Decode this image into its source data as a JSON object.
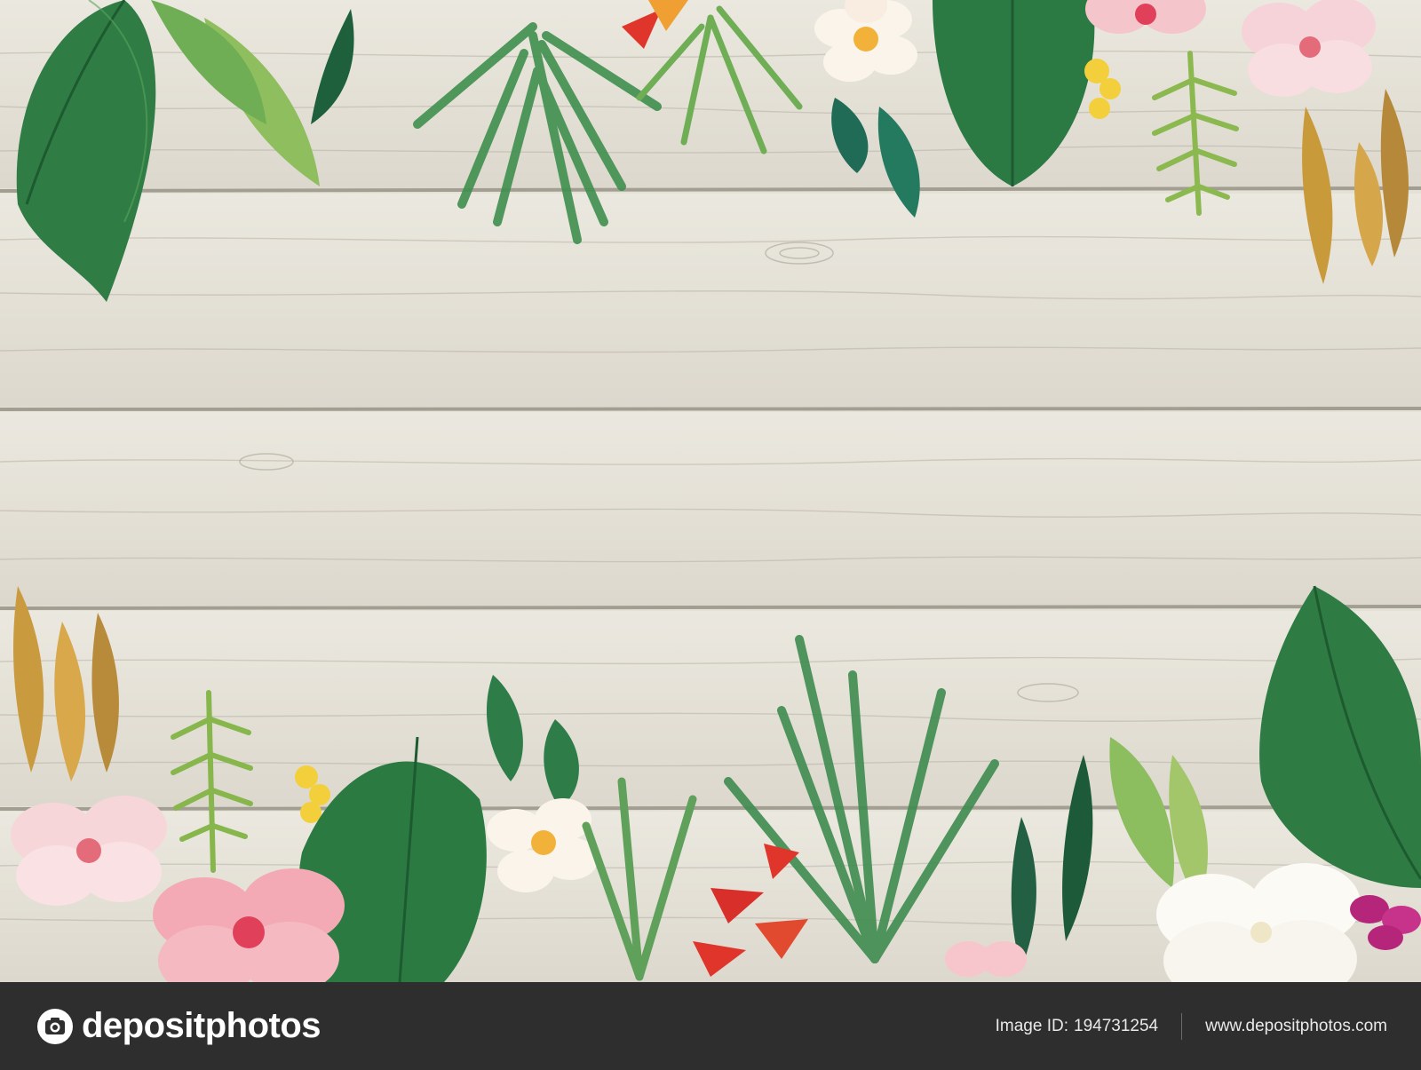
{
  "scene": {
    "description_colors": {
      "wood": "#e3e0d6",
      "plank_seam": "#8a857a",
      "leaf_dark": "#1f6b3a",
      "leaf_mid": "#3f8f4e",
      "leaf_light": "#8bbf5a",
      "hibiscus_pink": "#f3b6bd",
      "hibiscus_red": "#e0405a",
      "heliconia_red": "#e0352b",
      "plumeria_white": "#fbf4ea",
      "plumeria_center": "#f2b23a",
      "orchid_magenta": "#b5267a"
    }
  },
  "watermark": {
    "brand": "depositphotos",
    "logo_icon": "camera-icon",
    "image_id_label": "Image ID:",
    "image_id_value": "194731254",
    "site_url": "www.depositphotos.com",
    "bar_color": "#2e2e2e"
  }
}
